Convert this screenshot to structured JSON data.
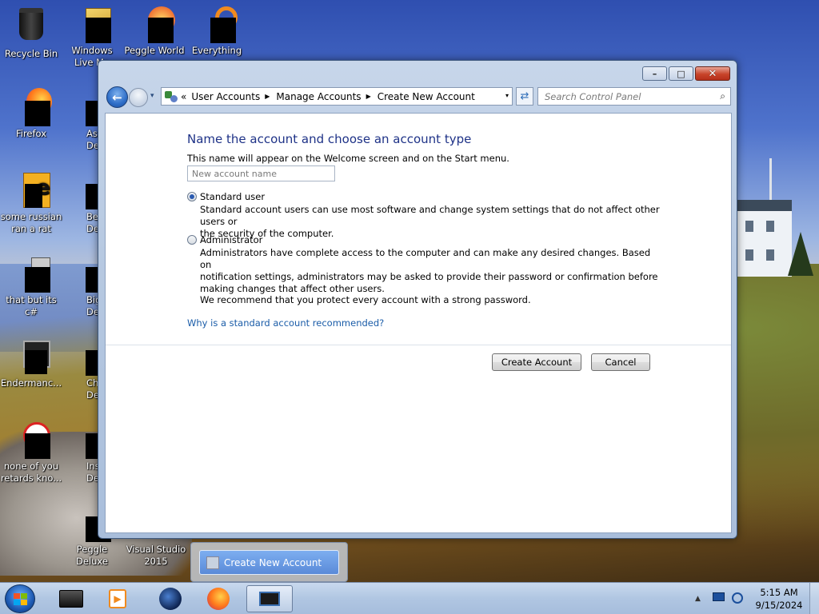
{
  "desktop": {
    "icons": [
      {
        "label": "Recycle Bin"
      },
      {
        "label": "Windows Live Ma"
      },
      {
        "label": "Peggle World"
      },
      {
        "label": "Everything"
      },
      {
        "label": "Firefox"
      },
      {
        "label": "Astrol Delu"
      },
      {
        "label": "some russian ran a rat"
      },
      {
        "label": "Bejew Delu"
      },
      {
        "label": "that but its c#"
      },
      {
        "label": "Big Mo Delu"
      },
      {
        "label": "Endermanc..."
      },
      {
        "label": "Chuz Delu"
      },
      {
        "label": "none of you retards kno..."
      },
      {
        "label": "Insaniq Delu"
      },
      {
        "label": "Peggle Deluxe"
      },
      {
        "label": "Visual Studio 2015"
      }
    ]
  },
  "window": {
    "title_buttons": {
      "minimize": "–",
      "maximize": "□",
      "close": "✕"
    },
    "nav": {
      "back_icon": "back-arrow-icon",
      "forward_icon": "forward-arrow-icon",
      "history_icon": "▾",
      "breadcrumb_prefix": "«",
      "crumbs": [
        "User Accounts",
        "Manage Accounts",
        "Create New Account"
      ],
      "crumb_sep": "▶",
      "dropdown": "▾",
      "refresh": "⇄",
      "search_placeholder": "Search Control Panel",
      "search_icon": "⌕"
    },
    "form": {
      "heading": "Name the account and choose an account type",
      "description": "This name will appear on the Welcome screen and on the Start menu.",
      "name_placeholder": "New account name",
      "options": [
        {
          "label": "Standard user",
          "checked": true,
          "desc_line1": "Standard account users can use most software and change system settings that do not affect other users or",
          "desc_line2": "the security of the computer."
        },
        {
          "label": "Administrator",
          "checked": false,
          "desc_line1": "Administrators have complete access to the computer and can make any desired changes. Based on",
          "desc_line2": "notification settings, administrators may be asked to provide their password or confirmation before",
          "desc_line3": "making changes that affect other users."
        }
      ],
      "recommend": "We recommend that you protect every account with a strong password.",
      "help_link": "Why is a standard account recommended?",
      "create_button": "Create Account",
      "cancel_button": "Cancel"
    }
  },
  "taskbar": {
    "thumbnail_label": "Create New Account",
    "clock_time": "5:15 AM",
    "clock_date": "9/15/2024",
    "tray_arrow": "▲",
    "start_icon": "windows-logo-icon"
  }
}
